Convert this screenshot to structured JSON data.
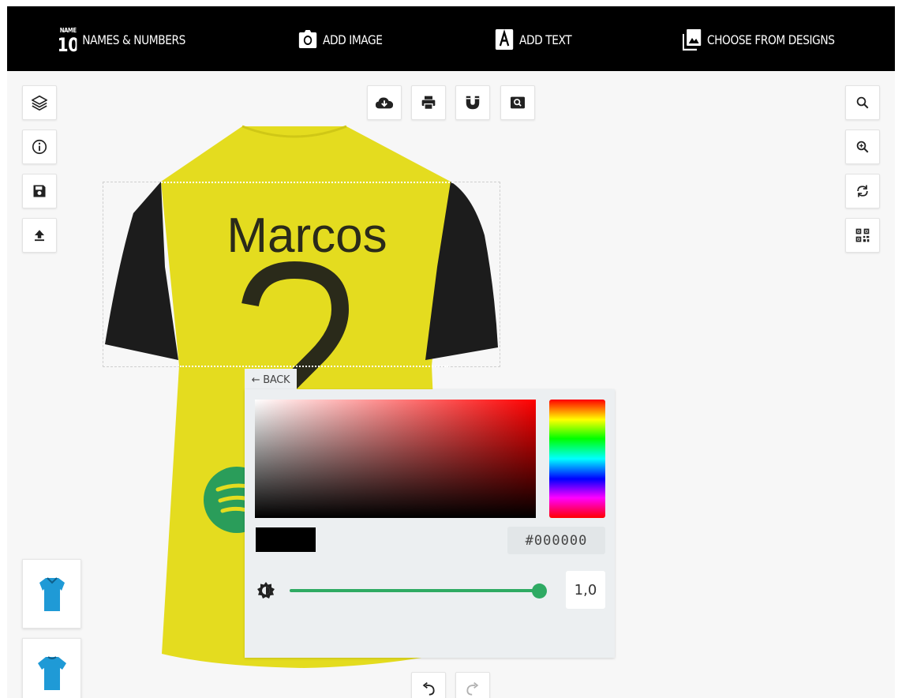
{
  "nav": {
    "names_numbers_label": "NAMES & NUMBERS",
    "names_icon_small": "NAME",
    "names_icon_big": "10",
    "add_image_label": "ADD IMAGE",
    "add_text_label": "ADD TEXT",
    "choose_designs_label": "CHOOSE FROM DESIGNS"
  },
  "icons": {
    "left_toolbar": [
      "layers-icon",
      "info-icon",
      "save-icon",
      "upload-icon"
    ],
    "top_toolbar": [
      "cloud-download-icon",
      "print-icon",
      "magnet-icon",
      "preview-zoom-icon"
    ],
    "right_toolbar": [
      "search-icon",
      "zoom-in-icon",
      "rotate-icon",
      "qr-code-icon"
    ],
    "bottom_toolbar": [
      "undo-icon",
      "redo-icon"
    ]
  },
  "shirt": {
    "player_name": "Marcos",
    "player_number": "2",
    "body_color": "#e4dc1f",
    "sleeve_color": "#1c1c1c",
    "logo_color": "#2a9d5a"
  },
  "picker": {
    "back_label": "← BACK",
    "hex_value": "#000000",
    "opacity_value": "1,0",
    "opacity_level": 1.0,
    "accent_color": "#2eaa63",
    "current_color": "#000000"
  }
}
